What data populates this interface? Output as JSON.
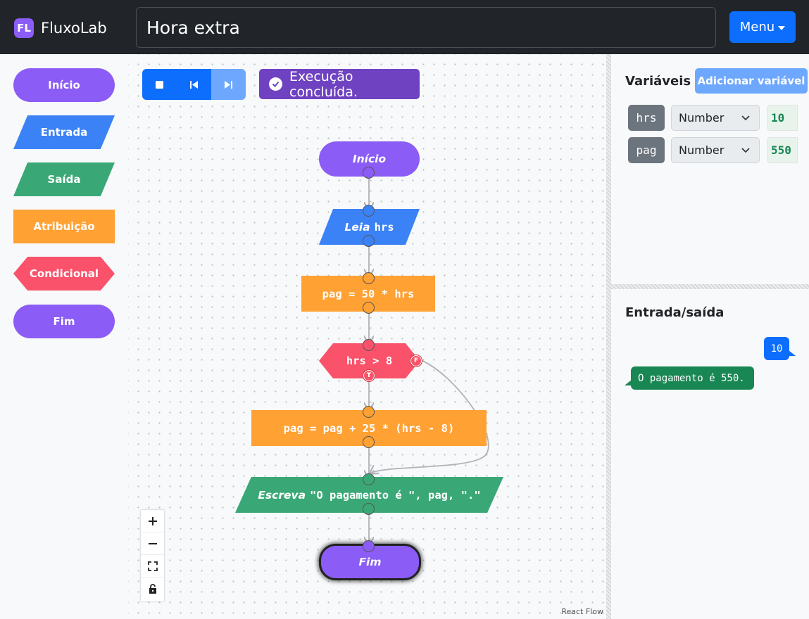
{
  "app": {
    "logo_text": "FL",
    "name": "FluxoLab"
  },
  "header": {
    "title_value": "Hora extra",
    "menu_label": "Menu"
  },
  "palette": {
    "items": [
      {
        "label": "Início",
        "kind": "start",
        "color": "#8b5cf6"
      },
      {
        "label": "Entrada",
        "kind": "input",
        "color": "#3b82f6"
      },
      {
        "label": "Saída",
        "kind": "output",
        "color": "#3aa876"
      },
      {
        "label": "Atribuição",
        "kind": "assign",
        "color": "#ffa133"
      },
      {
        "label": "Condicional",
        "kind": "conditional",
        "color": "#f9526a"
      },
      {
        "label": "Fim",
        "kind": "end",
        "color": "#8b5cf6"
      }
    ]
  },
  "toolbar": {
    "stop_icon": "stop-icon",
    "restart_icon": "skip-back-icon",
    "step_icon": "skip-forward-icon",
    "step_disabled": true
  },
  "status": {
    "text": "Execução concluída.",
    "icon": "check-circle-icon",
    "color": "#6f42c1"
  },
  "flow": {
    "start": {
      "label": "Início"
    },
    "read": {
      "keyword": "Leia",
      "expr": "hrs"
    },
    "assign1": {
      "expr": "pag = 50 * hrs"
    },
    "cond": {
      "expr": "hrs > 8",
      "true_label": "T",
      "false_label": "F"
    },
    "assign2": {
      "expr": "pag = pag + 25 * (hrs - 8)"
    },
    "write": {
      "keyword": "Escreva",
      "expr": "\"O pagamento é \", pag, \".\""
    },
    "end": {
      "label": "Fim",
      "highlighted": true
    }
  },
  "zoom_controls": [
    "plus-icon",
    "minus-icon",
    "fit-view-icon",
    "lock-icon"
  ],
  "attribution": "React Flow",
  "variables": {
    "title": "Variáveis",
    "add_label": "Adicionar variável",
    "items": [
      {
        "name": "hrs",
        "type": "Number",
        "value": "10"
      },
      {
        "name": "pag",
        "type": "Number",
        "value": "550"
      }
    ]
  },
  "io": {
    "title": "Entrada/saída",
    "messages": [
      {
        "direction": "in",
        "text": "10"
      },
      {
        "direction": "out",
        "text": "O pagamento é 550."
      }
    ]
  }
}
